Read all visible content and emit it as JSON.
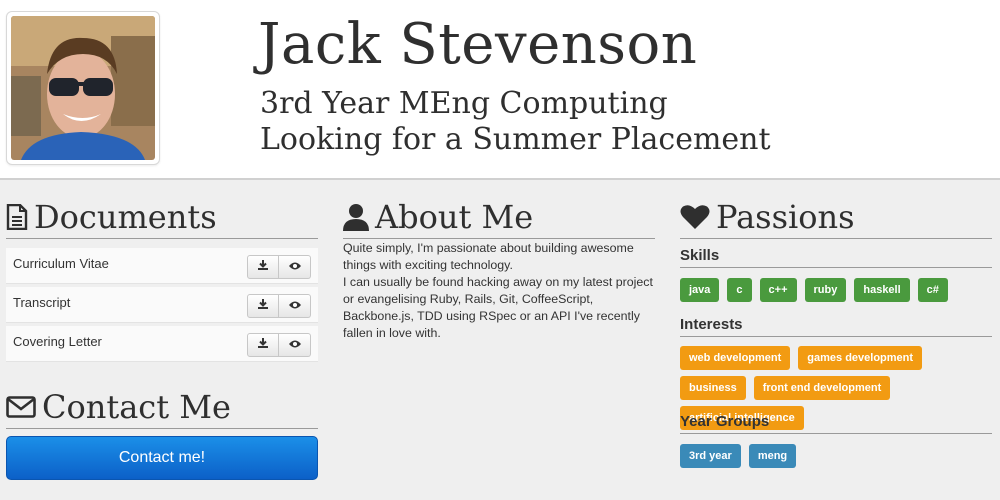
{
  "header": {
    "name": "Jack Stevenson",
    "subtitle_line1": "3rd Year MEng Computing",
    "subtitle_line2": "Looking for a Summer Placement"
  },
  "documents": {
    "title": "Documents",
    "icon": "file-icon",
    "items": [
      {
        "label": "Curriculum Vitae"
      },
      {
        "label": "Transcript"
      },
      {
        "label": "Covering Letter"
      }
    ]
  },
  "contact": {
    "title": "Contact Me",
    "icon": "envelope-icon",
    "button_label": "Contact me!"
  },
  "about": {
    "title": "About Me",
    "icon": "user-icon",
    "lines": [
      "Quite simply, I'm passionate about building awesome",
      "things with exciting technology.",
      "I can usually be found hacking away on my latest project",
      "or evangelising Ruby, Rails, Git, CoffeeScript,",
      "Backbone.js, TDD using RSpec or an API I've recently",
      "fallen in love with."
    ]
  },
  "passions": {
    "title": "Passions",
    "icon": "heart-icon",
    "skills": {
      "label": "Skills",
      "tags": [
        "java",
        "c",
        "c++",
        "ruby",
        "haskell",
        "c#"
      ]
    },
    "interests": {
      "label": "Interests",
      "tags": [
        "web development",
        "games development",
        "business",
        "front end development",
        "artificial intelligence"
      ]
    },
    "year_groups": {
      "label": "Year Groups",
      "tags": [
        "3rd year",
        "meng"
      ]
    }
  },
  "colors": {
    "skill_tag": "#4a9a3e",
    "interest_tag": "#f29b12",
    "year_tag": "#3a8ab8",
    "contact_button": "#1177dd"
  }
}
